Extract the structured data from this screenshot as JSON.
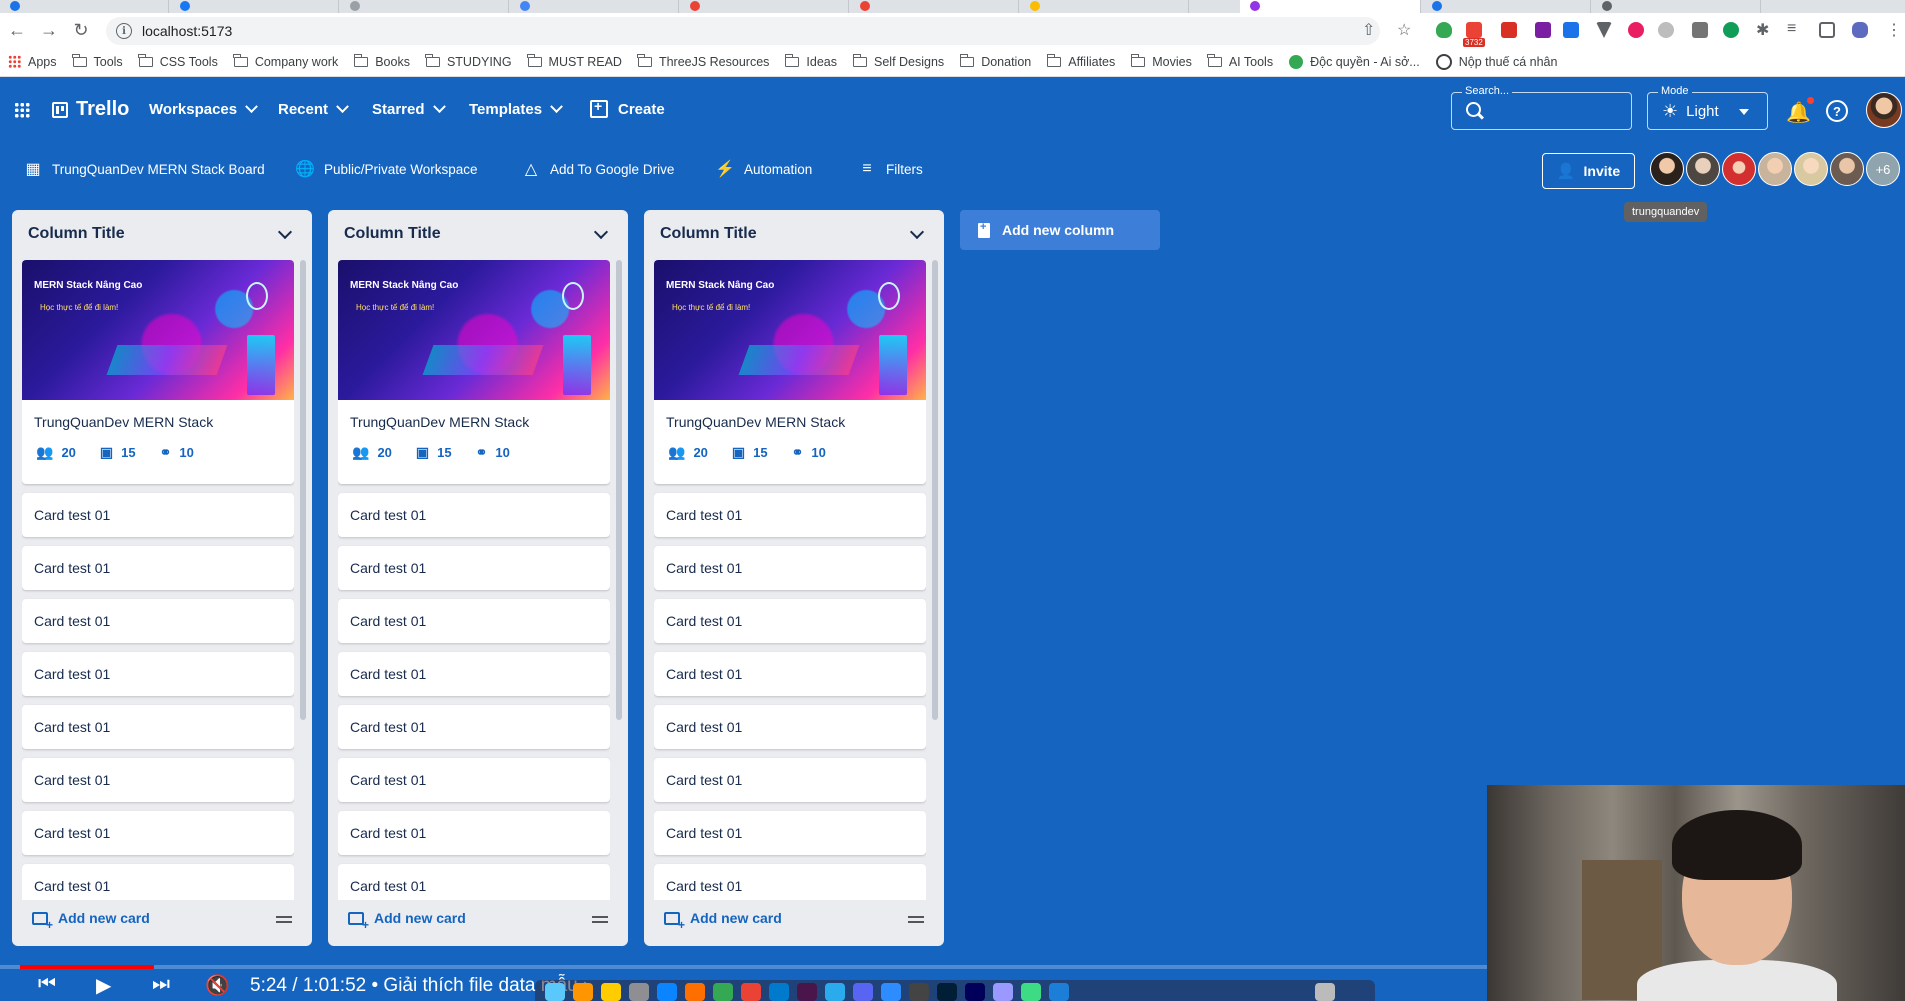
{
  "browser": {
    "url": "localhost:5173",
    "bookmarks": [
      {
        "label": "Apps",
        "kind": "apps"
      },
      {
        "label": "Tools",
        "kind": "folder"
      },
      {
        "label": "CSS Tools",
        "kind": "folder"
      },
      {
        "label": "Company work",
        "kind": "folder"
      },
      {
        "label": "Books",
        "kind": "folder"
      },
      {
        "label": "STUDYING",
        "kind": "folder"
      },
      {
        "label": "MUST READ",
        "kind": "folder"
      },
      {
        "label": "ThreeJS Resources",
        "kind": "folder"
      },
      {
        "label": "Ideas",
        "kind": "folder"
      },
      {
        "label": "Self Designs",
        "kind": "folder"
      },
      {
        "label": "Donation",
        "kind": "folder"
      },
      {
        "label": "Affiliates",
        "kind": "folder"
      },
      {
        "label": "Movies",
        "kind": "folder"
      },
      {
        "label": "AI Tools",
        "kind": "folder"
      },
      {
        "label": "Độc quyền - Ai sở...",
        "kind": "link"
      },
      {
        "label": "Nộp thuế cá nhân",
        "kind": "link"
      }
    ],
    "ext_badge": "3732"
  },
  "appbar": {
    "logo": "Trello",
    "menus": [
      "Workspaces",
      "Recent",
      "Starred",
      "Templates"
    ],
    "create": "Create",
    "search_legend": "Search...",
    "mode_legend": "Mode",
    "mode_value": "Light"
  },
  "boardbar": {
    "board_name": "TrungQuanDev MERN Stack Board",
    "workspace": "Public/Private Workspace",
    "drive": "Add To Google Drive",
    "automation": "Automation",
    "filters": "Filters",
    "invite": "Invite",
    "more_members": "+6",
    "tooltip": "trungquandev"
  },
  "columns": [
    {
      "title": "Column Title",
      "feature": {
        "title": "TrungQuanDev MERN Stack",
        "members": "20",
        "comments": "15",
        "attachments": "10",
        "cover_line1": "MERN Stack Nâng Cao",
        "cover_line2": "Học thực tế để đi làm!"
      },
      "cards": [
        "Card test 01",
        "Card test 01",
        "Card test 01",
        "Card test 01",
        "Card test 01",
        "Card test 01",
        "Card test 01",
        "Card test 01"
      ],
      "add_card": "Add new card"
    },
    {
      "title": "Column Title",
      "feature": {
        "title": "TrungQuanDev MERN Stack",
        "members": "20",
        "comments": "15",
        "attachments": "10",
        "cover_line1": "MERN Stack Nâng Cao",
        "cover_line2": "Học thực tế để đi làm!"
      },
      "cards": [
        "Card test 01",
        "Card test 01",
        "Card test 01",
        "Card test 01",
        "Card test 01",
        "Card test 01",
        "Card test 01",
        "Card test 01"
      ],
      "add_card": "Add new card"
    },
    {
      "title": "Column Title",
      "feature": {
        "title": "TrungQuanDev MERN Stack",
        "members": "20",
        "comments": "15",
        "attachments": "10",
        "cover_line1": "MERN Stack Nâng Cao",
        "cover_line2": "Học thực tế để đi làm!"
      },
      "cards": [
        "Card test 01",
        "Card test 01",
        "Card test 01",
        "Card test 01",
        "Card test 01",
        "Card test 01",
        "Card test 01",
        "Card test 01"
      ],
      "add_card": "Add new card"
    }
  ],
  "add_column": "Add new column",
  "player": {
    "time": "5:24 / 1:01:52 • Giải thích file data mẫu ›",
    "progress": 0.09
  },
  "colors": {
    "app_blue": "#1565c0",
    "column_bg": "#ebecf0",
    "accent": "#1565c0"
  }
}
